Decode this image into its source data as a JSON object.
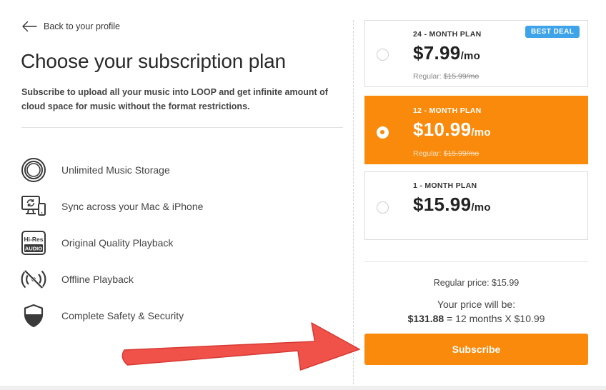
{
  "header": {
    "back_label": "Back to your profile",
    "title": "Choose your subscription plan",
    "description": "Subscribe to upload all your music into LOOP and get infinite amount of cloud space for music without the format restrictions."
  },
  "features": [
    {
      "icon": "storage-rings-icon",
      "label": "Unlimited Music Storage"
    },
    {
      "icon": "sync-devices-icon",
      "label": "Sync across your Mac & iPhone"
    },
    {
      "icon": "hi-res-audio-icon",
      "label": "Original Quality Playback",
      "icon_text": [
        "Hi-Res",
        "AUDIO"
      ]
    },
    {
      "icon": "offline-broadcast-icon",
      "label": "Offline Playback"
    },
    {
      "icon": "shield-icon",
      "label": "Complete Safety & Security"
    }
  ],
  "plans": [
    {
      "id": "24",
      "label": "24 - MONTH PLAN",
      "price": "$7.99",
      "per": "/mo",
      "regular_prefix": "Regular:",
      "regular_value": "$15.99/mo",
      "badge": "BEST DEAL",
      "selected": false
    },
    {
      "id": "12",
      "label": "12 - MONTH PLAN",
      "price": "$10.99",
      "per": "/mo",
      "regular_prefix": "Regular:",
      "regular_value": "$15.99/mo",
      "selected": true
    },
    {
      "id": "1",
      "label": "1 - MONTH PLAN",
      "price": "$15.99",
      "per": "/mo",
      "selected": false
    }
  ],
  "summary": {
    "regular_price": "Regular price: $15.99",
    "your_price_label": "Your price will be:",
    "total": "$131.88",
    "total_detail": " = 12 months X $10.99"
  },
  "subscribe_label": "Subscribe",
  "colors": {
    "accent": "#f98a0c",
    "badge": "#3ea3e8",
    "annotation_arrow": "#f0524a"
  },
  "annotation": {
    "type": "arrow",
    "points_to": "subscribe-button"
  }
}
